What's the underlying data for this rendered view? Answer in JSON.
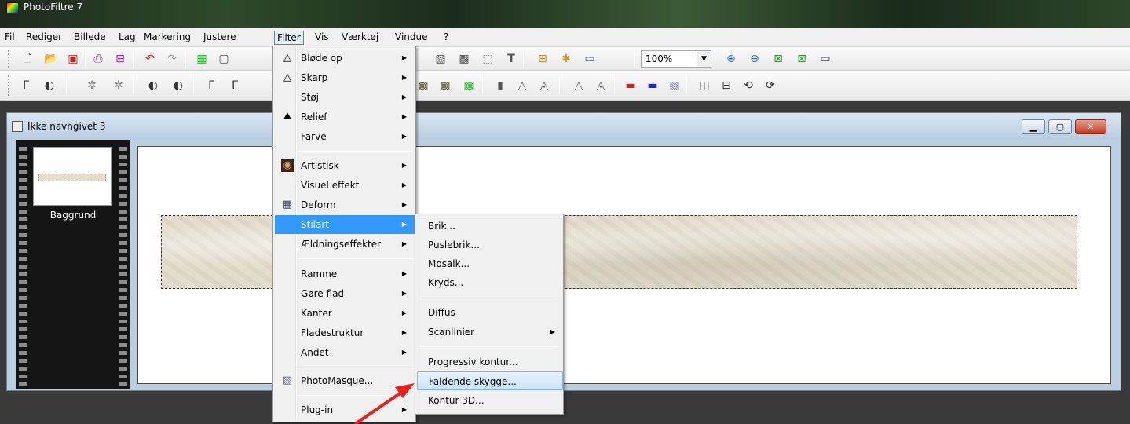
{
  "app": {
    "title": "PhotoFiltre 7"
  },
  "menubar": [
    "Fil",
    "Rediger",
    "Billede",
    "Lag",
    "Markering",
    "Justere",
    "Filter",
    "Vis",
    "Værktøj",
    "Vindue",
    "?"
  ],
  "zoom": {
    "value": "100%"
  },
  "document": {
    "title": "Ikke navngivet 3",
    "layer_label": "Baggrund"
  },
  "filter_menu": {
    "items": [
      "Bløde op",
      "Skarp",
      "Støj",
      "Relief",
      "Farve",
      "Artistisk",
      "Visuel effekt",
      "Deform",
      "Stilart",
      "Ældningseffekter",
      "Ramme",
      "Gøre flad",
      "Kanter",
      "Fladestruktur",
      "Andet",
      "PhotoMasque...",
      "Plug-in"
    ],
    "selected": "Stilart"
  },
  "stilart_menu": {
    "items": [
      "Brik...",
      "Puslebrik...",
      "Mosaik...",
      "Kryds...",
      "Diffus",
      "Scanlinier",
      "Progressiv kontur...",
      "Faldende skygge...",
      "Kontur 3D..."
    ],
    "highlighted": "Faldende skygge..."
  },
  "colors": {
    "highlight": "#3399ff",
    "annotation_arrow": "#e8201a"
  }
}
